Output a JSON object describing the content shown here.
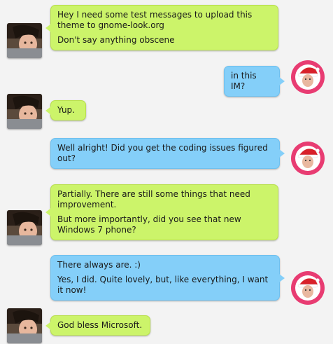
{
  "conversation": {
    "messages": [
      {
        "sender": "left",
        "bubble_color": "#ccf46a",
        "paragraphs": [
          "Hey I need some test messages to upload this theme to gnome-look.org",
          "Don't say anything obscene"
        ]
      },
      {
        "sender": "right",
        "bubble_color": "#84cff9",
        "paragraphs": [
          "in this IM?"
        ]
      },
      {
        "sender": "left",
        "bubble_color": "#ccf46a",
        "paragraphs": [
          "Yup."
        ]
      },
      {
        "sender": "right",
        "bubble_color": "#84cff9",
        "paragraphs": [
          "Well alright! Did you get the coding issues figured out?"
        ]
      },
      {
        "sender": "left",
        "bubble_color": "#ccf46a",
        "paragraphs": [
          "Partially. There are still some things that need improvement.",
          "But more importantly, did you see that new Windows 7 phone?"
        ]
      },
      {
        "sender": "right",
        "bubble_color": "#84cff9",
        "paragraphs": [
          "There always are. :)",
          "Yes, I did. Quite lovely, but, like everything, I want it now!"
        ]
      },
      {
        "sender": "left",
        "bubble_color": "#ccf46a",
        "paragraphs": [
          "God bless Microsoft."
        ]
      }
    ]
  },
  "avatars": {
    "left_icon": "user-photo-icon",
    "right_icon": "santa-hat-buddy-icon",
    "right_ring_color": "#e83c72"
  }
}
